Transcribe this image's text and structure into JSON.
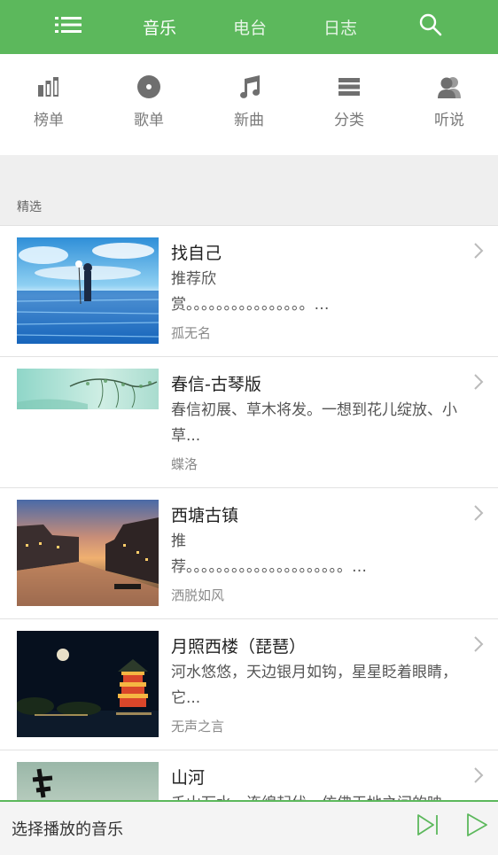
{
  "topbar": {
    "menu_icon": "list-icon",
    "tabs": [
      {
        "label": "音乐",
        "active": true
      },
      {
        "label": "电台",
        "active": false
      },
      {
        "label": "日志",
        "active": false
      }
    ],
    "search_icon": "search-icon",
    "accent": "#5cb85c"
  },
  "categories": [
    {
      "label": "榜单",
      "icon": "bar-chart-icon"
    },
    {
      "label": "歌单",
      "icon": "disc-icon"
    },
    {
      "label": "新曲",
      "icon": "music-note-icon"
    },
    {
      "label": "分类",
      "icon": "stack-icon"
    },
    {
      "label": "听说",
      "icon": "users-icon"
    }
  ],
  "section": {
    "label": "精选"
  },
  "items": [
    {
      "title": "找自己",
      "desc": "推荐欣赏。。。。。。。。。。。。。。。。。。。。。。。",
      "desc_display": "推荐欣\n赏。。。。。。。。。。。。。。。。…",
      "author": "孤无名"
    },
    {
      "title": "春信-古琴版",
      "desc": "春信初展、草木将发。一想到花儿绽放、小草...",
      "author": "蝶洛"
    },
    {
      "title": "西塘古镇",
      "desc": "推\n荐。。。。。。。。。。。。。。。。。。。。。…",
      "author": "洒脱如风"
    },
    {
      "title": "月照西楼（琵琶）",
      "desc": "河水悠悠，天边银月如钩，星星眨着眼睛，它...",
      "author": "无声之言"
    },
    {
      "title": "山河",
      "desc": "千山万水，连绵起伏，仿佛天地之间的映",
      "author": ""
    }
  ],
  "player": {
    "title": "选择播放的音乐",
    "next_icon": "skip-next-icon",
    "play_icon": "play-icon"
  }
}
